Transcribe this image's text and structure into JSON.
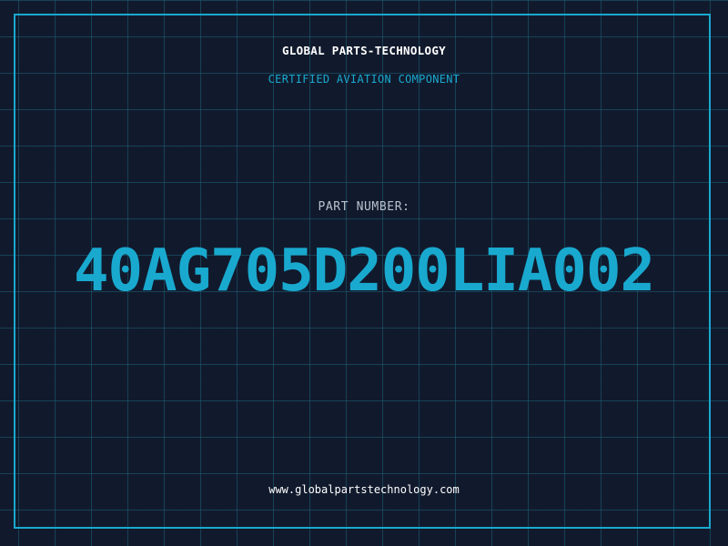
{
  "header": {
    "company": "GLOBAL PARTS-TECHNOLOGY",
    "tagline": "CERTIFIED AVIATION COMPONENT"
  },
  "part": {
    "label": "PART NUMBER:",
    "number": "40AG705D200LIA002"
  },
  "footer": {
    "url": "www.globalpartstechnology.com"
  },
  "colors": {
    "background": "#111a2d",
    "grid": "#1c6076",
    "accent": "#19a9cf",
    "text": "#ffffff",
    "muted": "#b9c2cc"
  }
}
